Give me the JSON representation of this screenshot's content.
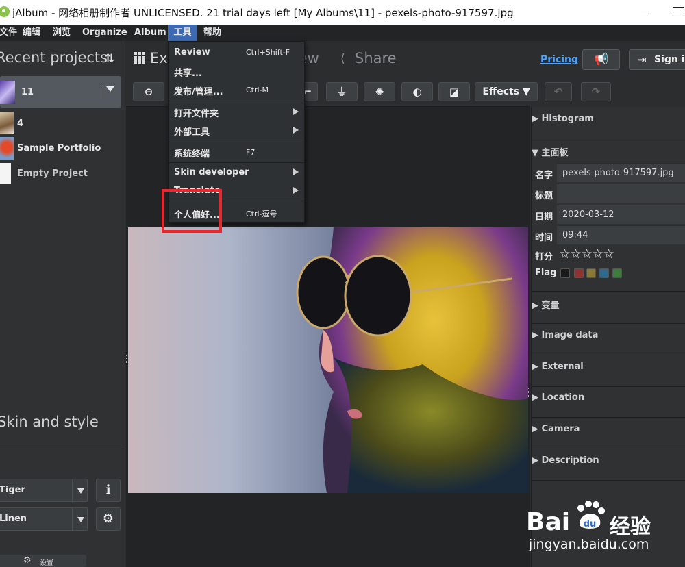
{
  "window": {
    "title": "jAlbum - 网络相册制作者 UNLICENSED. 21 trial days left [My Albums\\11] - pexels-photo-917597.jpg"
  },
  "menubar": {
    "items": [
      "文件",
      "编辑",
      "浏览",
      "Organize",
      "Album",
      "工具",
      "帮助"
    ],
    "active": "工具"
  },
  "tools_menu": {
    "items": [
      {
        "label": "Review",
        "shortcut": "Ctrl+Shift-F"
      },
      {
        "label": "共享...",
        "shortcut": ""
      },
      {
        "label": "发布/管理...",
        "shortcut": "Ctrl-M"
      },
      {
        "label": "打开文件夹",
        "submenu": true
      },
      {
        "label": "外部工具",
        "submenu": true
      },
      {
        "label": "系统终端",
        "shortcut": "F7"
      },
      {
        "label": "Skin developer",
        "submenu": true
      },
      {
        "label": "Translate",
        "submenu": true
      },
      {
        "label": "个人偏好...",
        "shortcut": "Ctrl-逗号"
      }
    ]
  },
  "left_panel": {
    "header": "Recent projects",
    "projects": [
      {
        "name": "11",
        "selected": true
      },
      {
        "name": "4"
      },
      {
        "name": "Sample Portfolio"
      },
      {
        "name": "Empty Project"
      }
    ],
    "skin_header": "Skin and style",
    "skin_value": "Tiger",
    "style_value": "Linen",
    "bottom_button": "设置"
  },
  "tabs": {
    "explore": "Explore",
    "preview": "Preview",
    "share": "Share"
  },
  "toolbar": {
    "effects_label": "Effects"
  },
  "header_right": {
    "pricing": "Pricing",
    "sign_in": "Sign in"
  },
  "right_panel": {
    "histogram": "Histogram",
    "main_panel": "主面板",
    "fields": [
      {
        "label": "名字",
        "value": "pexels-photo-917597.jpg"
      },
      {
        "label": "标题",
        "value": ""
      },
      {
        "label": "日期",
        "value": "2020-03-12"
      },
      {
        "label": "时间",
        "value": "09:44"
      }
    ],
    "rating_label": "打分",
    "rating_stars": "☆☆☆☆☆",
    "flag_label": "Flag",
    "flag_colors": [
      "#1a1a1a",
      "#8a3434",
      "#8a7a3a",
      "#2f6a8a",
      "#3f7a3f"
    ],
    "sections": [
      "变量",
      "Image data",
      "External",
      "Location",
      "Camera",
      "Description"
    ]
  },
  "watermark": {
    "brand_left": "Bai",
    "brand_right": "经验",
    "url": "jingyan.baidu.com"
  }
}
